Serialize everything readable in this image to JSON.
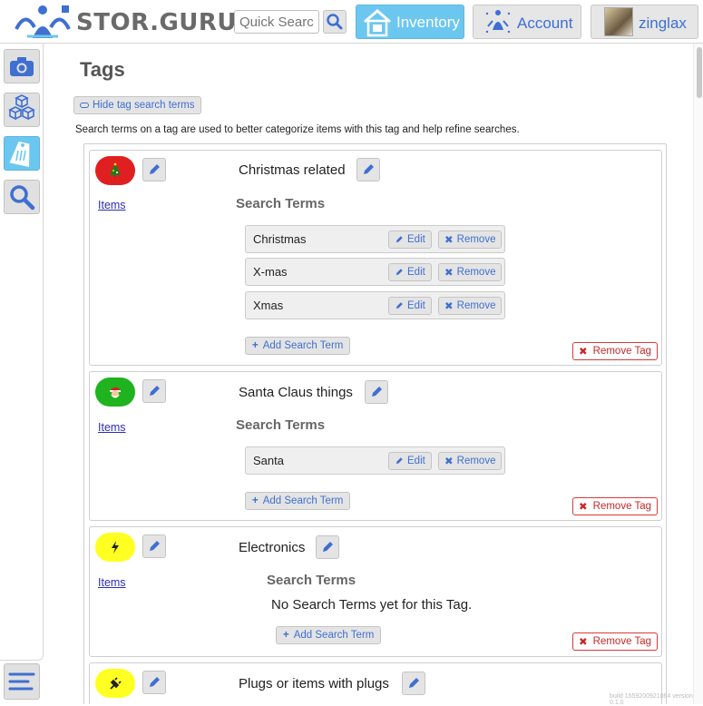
{
  "header": {
    "brand": "STOR.GURU",
    "search_placeholder": "Quick Search",
    "inventory_label": "Inventory",
    "account_label": "Account",
    "user_label": "zinglax"
  },
  "page": {
    "title": "Tags",
    "hide_terms_label": "Hide tag search terms",
    "description": "Search terms on a tag are used to better categorize items with this tag and help refine searches."
  },
  "labels": {
    "items": "Items",
    "search_terms": "Search Terms",
    "edit": "Edit",
    "remove": "Remove",
    "add_search_term": "Add Search Term",
    "remove_tag": "Remove Tag",
    "no_terms": "No Search Terms yet for this Tag."
  },
  "tags": [
    {
      "name": "Christmas related",
      "color": "#e02020",
      "icon": "christmas-tree-icon",
      "terms": [
        "Christmas",
        "X-mas",
        "Xmas"
      ]
    },
    {
      "name": "Santa Claus things",
      "color": "#1fb31f",
      "icon": "santa-icon",
      "terms": [
        "Santa"
      ]
    },
    {
      "name": "Electronics",
      "color": "#ffff22",
      "icon": "lightning-icon",
      "terms": []
    },
    {
      "name": "Plugs or items with plugs",
      "color": "#ffff22",
      "icon": "plug-icon",
      "terms": []
    }
  ],
  "footer": {
    "build": "build 1559200921064 version 0.1.0"
  },
  "colors": {
    "accent": "#3f6fd1",
    "active": "#6cc7f0",
    "danger": "#c62828"
  }
}
